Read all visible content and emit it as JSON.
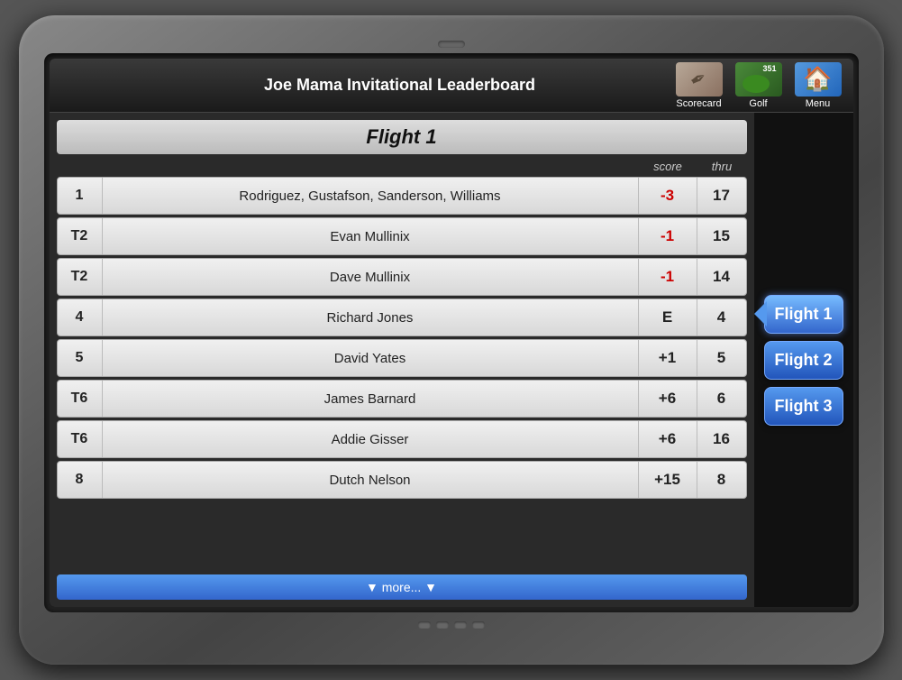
{
  "device": {
    "header": {
      "title": "Joe Mama Invitational Leaderboard",
      "icons": [
        {
          "name": "scorecard",
          "label": "Scorecard"
        },
        {
          "name": "golf",
          "label": "Golf"
        },
        {
          "name": "menu",
          "label": "Menu"
        }
      ]
    },
    "leaderboard": {
      "flight_title": "Flight 1",
      "col_score": "score",
      "col_thru": "thru",
      "rows": [
        {
          "rank": "1",
          "name": "Rodriguez, Gustafson, Sanderson, Williams",
          "score": "-3",
          "thru": "17",
          "score_type": "neg"
        },
        {
          "rank": "T2",
          "name": "Evan Mullinix",
          "score": "-1",
          "thru": "15",
          "score_type": "neg"
        },
        {
          "rank": "T2",
          "name": "Dave Mullinix",
          "score": "-1",
          "thru": "14",
          "score_type": "neg"
        },
        {
          "rank": "4",
          "name": "Richard Jones",
          "score": "E",
          "thru": "4",
          "score_type": "even"
        },
        {
          "rank": "5",
          "name": "David Yates",
          "score": "+1",
          "thru": "5",
          "score_type": "pos"
        },
        {
          "rank": "T6",
          "name": "James Barnard",
          "score": "+6",
          "thru": "6",
          "score_type": "pos"
        },
        {
          "rank": "T6",
          "name": "Addie Gisser",
          "score": "+6",
          "thru": "16",
          "score_type": "pos"
        },
        {
          "rank": "8",
          "name": "Dutch Nelson",
          "score": "+15",
          "thru": "8",
          "score_type": "pos"
        }
      ],
      "more_label": "▼  more...  ▼"
    },
    "sidebar": {
      "flights": [
        {
          "label": "Flight 1",
          "active": true
        },
        {
          "label": "Flight 2",
          "active": false
        },
        {
          "label": "Flight 3",
          "active": false
        }
      ]
    }
  }
}
